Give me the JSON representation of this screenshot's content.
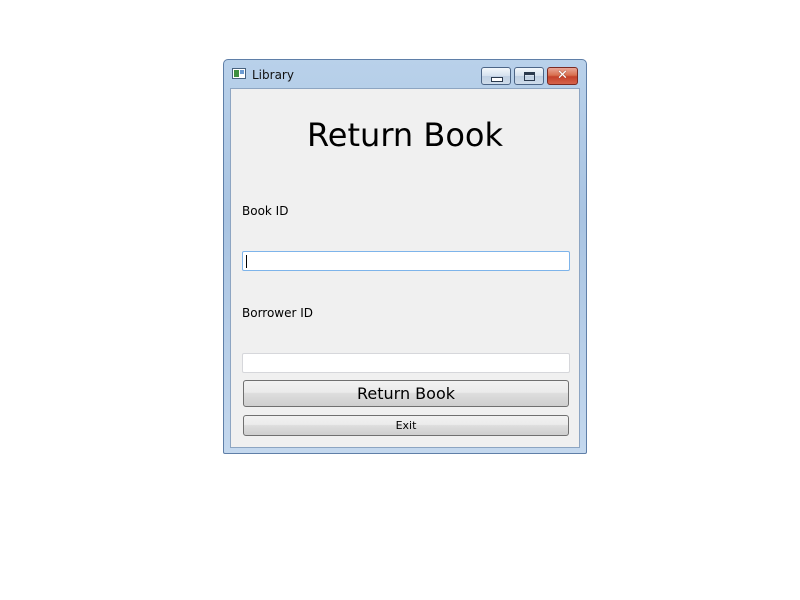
{
  "window": {
    "title": "Library",
    "minimize_icon": "minimize-icon",
    "maximize_icon": "maximize-icon",
    "close_icon": "close-icon",
    "close_glyph": "✕"
  },
  "form": {
    "heading": "Return Book",
    "book_id_label": "Book ID",
    "book_id_value": "",
    "borrower_id_label": "Borrower ID",
    "borrower_id_value": "",
    "return_button_label": "Return Book",
    "exit_button_label": "Exit"
  },
  "colors": {
    "focus_border": "#7eb4ea",
    "close_button": "#c5412a",
    "client_background": "#f0f0f0"
  }
}
